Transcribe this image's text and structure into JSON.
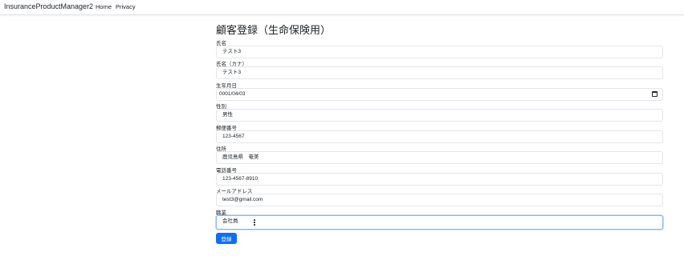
{
  "nav": {
    "brand": "InsuranceProductManager2",
    "home": "Home",
    "privacy": "Privacy"
  },
  "page": {
    "title": "顧客登録（生命保険用）"
  },
  "form": {
    "fields": [
      {
        "label": "氏名",
        "value": "テスト3"
      },
      {
        "label": "氏名（カナ）",
        "value": "テスト3"
      },
      {
        "label": "生年月日",
        "value": "0001/04/03",
        "icon": "calendar-icon"
      },
      {
        "label": "性別",
        "value": "男性"
      },
      {
        "label": "郵便番号",
        "value": "123-4567"
      },
      {
        "label": "住所",
        "value": "鹿児島県　奄美"
      },
      {
        "label": "電話番号",
        "value": "123-4567-8910"
      },
      {
        "label": "メールアドレス",
        "value": "test3@gmail.com"
      },
      {
        "label": "職業",
        "value": "会社員",
        "icon": "select-dots-icon"
      }
    ],
    "submit_label": "登録"
  },
  "colors": {
    "accent": "#0d6efd",
    "focus_border": "#86b7fe"
  }
}
